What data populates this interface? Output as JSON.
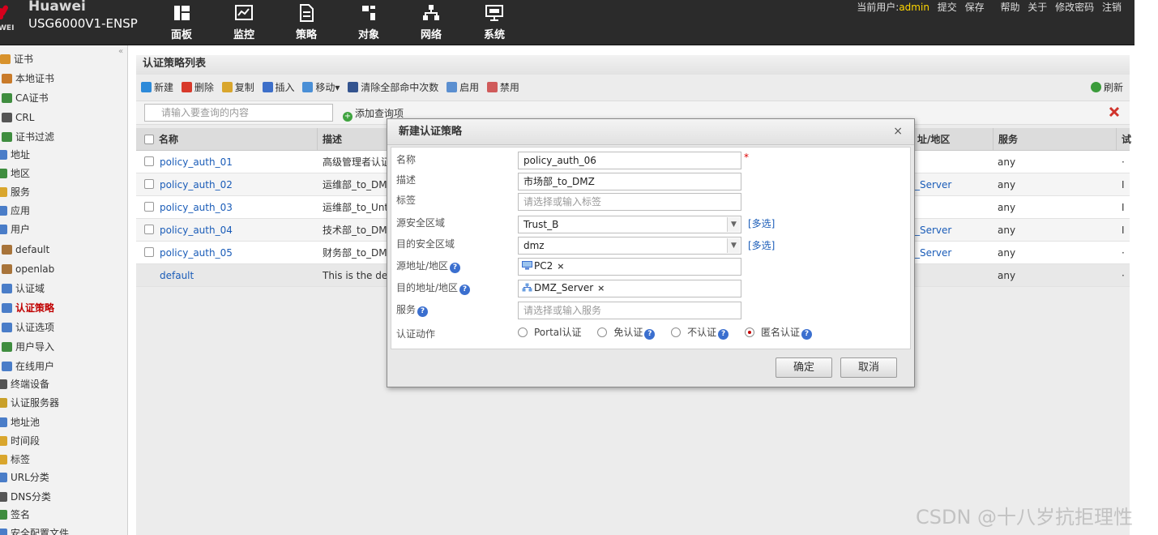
{
  "header": {
    "brand_name": "Huawei",
    "brand_logo_text": "WEI",
    "model": "USG6000V1-ENSP",
    "nav": [
      {
        "label": "面板",
        "icon": "dashboard-icon"
      },
      {
        "label": "监控",
        "icon": "monitor-chart-icon"
      },
      {
        "label": "策略",
        "icon": "policy-document-icon"
      },
      {
        "label": "对象",
        "icon": "object-icon"
      },
      {
        "label": "网络",
        "icon": "network-icon"
      },
      {
        "label": "系统",
        "icon": "system-monitor-icon"
      }
    ],
    "topbar": {
      "current_user_label": "当前用户:",
      "user": "admin",
      "links": [
        "提交",
        "保存",
        "帮助",
        "关于",
        "修改密码",
        "注销"
      ]
    }
  },
  "sidebar": {
    "collapse": "«",
    "items": [
      {
        "label": "证书",
        "icon": "certificate-icon"
      },
      {
        "label": "本地证书",
        "icon": "local-cert-icon"
      },
      {
        "label": "CA证书",
        "icon": "ca-cert-icon"
      },
      {
        "label": "CRL",
        "icon": "crl-icon"
      },
      {
        "label": "证书过滤",
        "icon": "cert-filter-icon"
      },
      {
        "label": "地址",
        "icon": "address-icon"
      },
      {
        "label": "地区",
        "icon": "region-icon"
      },
      {
        "label": "服务",
        "icon": "service-icon"
      },
      {
        "label": "应用",
        "icon": "application-icon"
      },
      {
        "label": "用户",
        "icon": "user-icon"
      },
      {
        "label": "default",
        "icon": "user-group-icon"
      },
      {
        "label": "openlab",
        "icon": "user-group-icon"
      },
      {
        "label": "认证域",
        "icon": "auth-domain-icon"
      },
      {
        "label": "认证策略",
        "icon": "auth-policy-icon"
      },
      {
        "label": "认证选项",
        "icon": "auth-option-icon"
      },
      {
        "label": "用户导入",
        "icon": "user-import-icon"
      },
      {
        "label": "在线用户",
        "icon": "online-user-icon"
      },
      {
        "label": "终端设备",
        "icon": "terminal-icon"
      },
      {
        "label": "认证服务器",
        "icon": "auth-server-icon"
      },
      {
        "label": "地址池",
        "icon": "address-pool-icon"
      },
      {
        "label": "时间段",
        "icon": "time-range-icon"
      },
      {
        "label": "标签",
        "icon": "tag-icon"
      },
      {
        "label": "URL分类",
        "icon": "url-category-icon"
      },
      {
        "label": "DNS分类",
        "icon": "dns-category-icon"
      },
      {
        "label": "签名",
        "icon": "signature-icon"
      },
      {
        "label": "安全配置文件",
        "icon": "security-profile-icon"
      }
    ]
  },
  "main": {
    "title": "认证策略列表",
    "toolbar": [
      {
        "label": "新建",
        "icon": "plus-icon"
      },
      {
        "label": "删除",
        "icon": "delete-icon"
      },
      {
        "label": "复制",
        "icon": "copy-icon"
      },
      {
        "label": "插入",
        "icon": "insert-icon"
      },
      {
        "label": "移动▾",
        "icon": "move-icon"
      },
      {
        "label": "清除全部命中次数",
        "icon": "clear-hits-icon"
      },
      {
        "label": "启用",
        "icon": "enable-icon"
      },
      {
        "label": "禁用",
        "icon": "disable-icon"
      }
    ],
    "refresh": "刷新",
    "search_placeholder": "请输入要查询的内容",
    "add_query": "添加查询项",
    "columns": {
      "name": "名称",
      "desc": "描述",
      "dst": "址/地区",
      "service": "服务",
      "extra": "试"
    },
    "rows": [
      {
        "name": "policy_auth_01",
        "desc": "高级管理者认证",
        "dst": "",
        "service": "any",
        "extra": "·"
      },
      {
        "name": "policy_auth_02",
        "desc": "运维部_to_DMZ",
        "dst": "_Server",
        "service": "any",
        "extra": "I"
      },
      {
        "name": "policy_auth_03",
        "desc": "运维部_to_Untrust",
        "dst": "",
        "service": "any",
        "extra": "I"
      },
      {
        "name": "policy_auth_04",
        "desc": "技术部_to_DMZ",
        "dst": "_Server",
        "service": "any",
        "extra": "I"
      },
      {
        "name": "policy_auth_05",
        "desc": "财务部_to_DMZ",
        "dst": "_Server",
        "service": "any",
        "extra": "·"
      },
      {
        "name": "default",
        "desc": "This is the default rule",
        "dst": "",
        "service": "any",
        "extra": "·"
      }
    ]
  },
  "dialog": {
    "title": "新建认证策略",
    "close": "×",
    "fields": {
      "name_label": "名称",
      "name_value": "policy_auth_06",
      "required_mark": "*",
      "desc_label": "描述",
      "desc_value": "市场部_to_DMZ",
      "tag_label": "标签",
      "tag_placeholder": "请选择或输入标签",
      "src_zone_label": "源安全区域",
      "src_zone_value": "Trust_B",
      "dst_zone_label": "目的安全区域",
      "dst_zone_value": "dmz",
      "multi_select": "[多选]",
      "src_addr_label": "源地址/地区",
      "src_addr_tag": "PC2",
      "dst_addr_label": "目的地址/地区",
      "dst_addr_tag": "DMZ_Server",
      "service_label": "服务",
      "service_placeholder": "请选择或输入服务",
      "action_label": "认证动作",
      "help": "?"
    },
    "actions": [
      {
        "label": "Portal认证",
        "selected": false,
        "help": false
      },
      {
        "label": "免认证",
        "selected": false,
        "help": true
      },
      {
        "label": "不认证",
        "selected": false,
        "help": true
      },
      {
        "label": "匿名认证",
        "selected": true,
        "help": true
      }
    ],
    "ok": "确定",
    "cancel": "取消",
    "remove_tag": "×"
  },
  "watermark": "CSDN @十八岁抗拒理性",
  "colors": {
    "header_bg": "#2b2b2b",
    "link": "#1a5cb8",
    "active": "#c00000",
    "username": "#ffd700",
    "brand_red": "#d6001c"
  }
}
